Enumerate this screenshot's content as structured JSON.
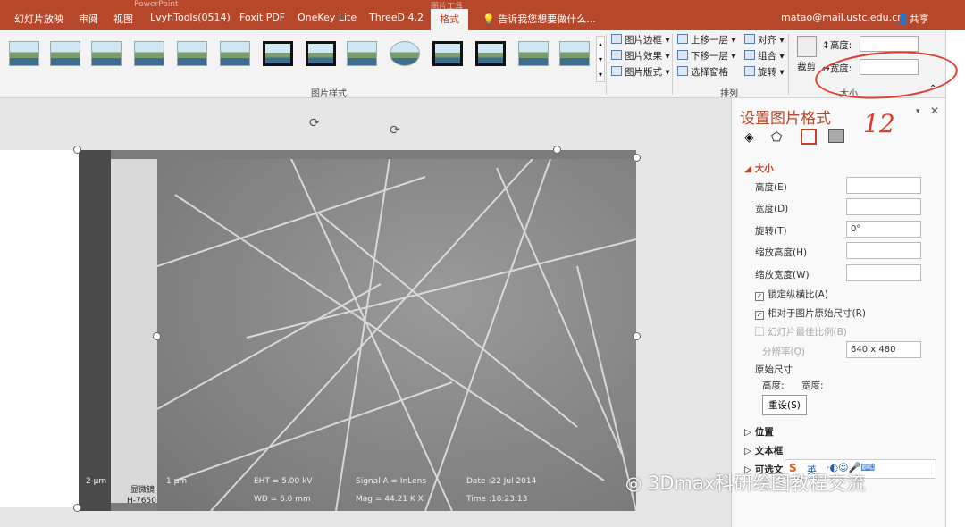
{
  "ribbon_tabs": [
    "幻灯片放映",
    "审阅",
    "视图",
    "LvyhTools(0514)",
    "Foxit PDF",
    "OneKey Lite",
    "ThreeD 4.2",
    "格式"
  ],
  "active_tab": "格式",
  "tell_me": "告诉我您想要做什么...",
  "account": "matao@mail.ustc.edu.cn",
  "share": "共享",
  "title_fragment": "PowerPoint",
  "context_tab_fragment": "图片工具",
  "picture_styles_label": "图片样式",
  "picture_buttons": [
    "图片边框",
    "图片效果",
    "图片版式"
  ],
  "arrange": {
    "label": "排列",
    "buttons": [
      "上移一层",
      "下移一层",
      "选择窗格",
      "对齐",
      "组合",
      "旋转"
    ]
  },
  "crop_label": "裁剪",
  "size_group": {
    "label": "大小",
    "height_label": "高度:",
    "width_label": "宽度:",
    "height_value": "",
    "width_value": ""
  },
  "sem_info": {
    "scale": "1 μm",
    "eht": "EHT = 5.00 kV",
    "wd": "WD = 6.0 mm",
    "signal": "Signal A = InLens",
    "mag": "Mag = 44.21 K X",
    "date": "Date :22 Jul 2014",
    "time": "Time :18:23:13",
    "left_scale": "2 μm",
    "left_label": "显微镜",
    "left_model": "H-7650"
  },
  "panel": {
    "title": "设置图片格式",
    "size_section": "大小",
    "fields": [
      {
        "label": "高度(E)",
        "value": ""
      },
      {
        "label": "宽度(D)",
        "value": ""
      },
      {
        "label": "旋转(T)",
        "value": "0°"
      },
      {
        "label": "缩放高度(H)",
        "value": ""
      },
      {
        "label": "缩放宽度(W)",
        "value": ""
      }
    ],
    "lock_aspect": "锁定纵横比(A)",
    "relative_size": "相对于图片原始尺寸(R)",
    "best_scale": "幻灯片最佳比例(B)",
    "resolution_label": "分辨率(O)",
    "resolution_value": "640 x 480",
    "original_size": "原始尺寸",
    "orig_height": "高度:",
    "orig_width": "宽度:",
    "reset": "重设(S)",
    "sections": [
      "位置",
      "文本框",
      "可选文"
    ]
  },
  "annotation_number": "12",
  "watermark": "3Dmax科研绘图教程交流",
  "ime_label": "英"
}
